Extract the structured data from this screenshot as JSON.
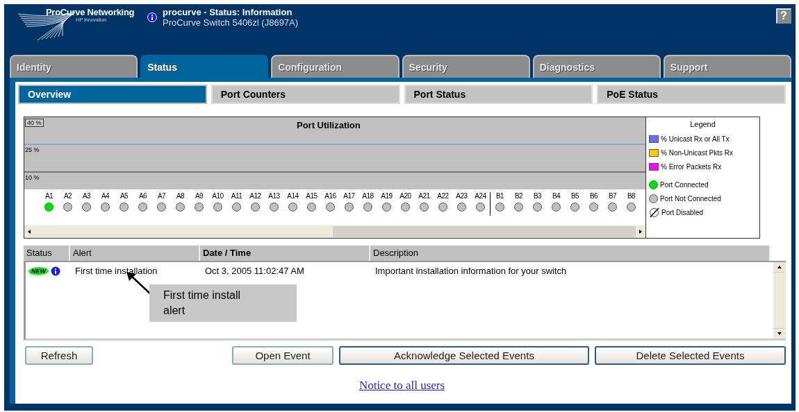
{
  "header": {
    "brand": "ProCurve Networking",
    "tagline": "HP Innovation",
    "title": "procurve -  Status: Information",
    "subtitle": "ProCurve Switch 5406zl (J8697A)",
    "help": "?"
  },
  "tabs": [
    {
      "label": "Identity",
      "selected": false
    },
    {
      "label": "Status",
      "selected": true
    },
    {
      "label": "Configuration",
      "selected": false
    },
    {
      "label": "Security",
      "selected": false
    },
    {
      "label": "Diagnostics",
      "selected": false
    },
    {
      "label": "Support",
      "selected": false
    }
  ],
  "subtabs": [
    {
      "label": "Overview",
      "selected": true
    },
    {
      "label": "Port Counters",
      "selected": false
    },
    {
      "label": "Port Status",
      "selected": false
    },
    {
      "label": "PoE Status",
      "selected": false
    }
  ],
  "utilization": {
    "title": "Port Utilization",
    "scale_labels": [
      "40 %",
      "25 %",
      "10 %"
    ],
    "ports": [
      {
        "label": "A1",
        "connected": true
      },
      {
        "label": "A2",
        "connected": false
      },
      {
        "label": "A3",
        "connected": false
      },
      {
        "label": "A4",
        "connected": false
      },
      {
        "label": "A5",
        "connected": false
      },
      {
        "label": "A6",
        "connected": false
      },
      {
        "label": "A7",
        "connected": false
      },
      {
        "label": "A8",
        "connected": false
      },
      {
        "label": "A9",
        "connected": false
      },
      {
        "label": "A10",
        "connected": false
      },
      {
        "label": "A11",
        "connected": false
      },
      {
        "label": "A12",
        "connected": false
      },
      {
        "label": "A13",
        "connected": false
      },
      {
        "label": "A14",
        "connected": false
      },
      {
        "label": "A15",
        "connected": false
      },
      {
        "label": "A16",
        "connected": false
      },
      {
        "label": "A17",
        "connected": false
      },
      {
        "label": "A18",
        "connected": false
      },
      {
        "label": "A19",
        "connected": false
      },
      {
        "label": "A20",
        "connected": false
      },
      {
        "label": "A21",
        "connected": false
      },
      {
        "label": "A22",
        "connected": false
      },
      {
        "label": "A23",
        "connected": false
      },
      {
        "label": "A24",
        "connected": false
      },
      {
        "label": "B1",
        "connected": false
      },
      {
        "label": "B2",
        "connected": false
      },
      {
        "label": "B3",
        "connected": false
      },
      {
        "label": "B4",
        "connected": false
      },
      {
        "label": "B5",
        "connected": false
      },
      {
        "label": "B6",
        "connected": false
      },
      {
        "label": "B7",
        "connected": false
      },
      {
        "label": "B8",
        "connected": false
      }
    ],
    "legend": {
      "title": "Legend",
      "items": [
        {
          "kind": "swatch",
          "color": "#6b6bff",
          "label": "% Unicast Rx or All Tx"
        },
        {
          "kind": "swatch",
          "color": "#ffcc00",
          "label": "% Non-Unicast Pkts Rx"
        },
        {
          "kind": "swatch",
          "color": "#ff00ff",
          "label": "% Error Packets Rx"
        },
        {
          "kind": "port",
          "connected": true,
          "disabled": false,
          "label": "Port Connected"
        },
        {
          "kind": "port",
          "connected": false,
          "disabled": false,
          "label": "Port Not Connected"
        },
        {
          "kind": "port",
          "connected": false,
          "disabled": true,
          "label": "Port Disabled"
        }
      ]
    }
  },
  "alerts": {
    "columns": [
      "Status",
      "Alert",
      "Date / Time",
      "Description"
    ],
    "rows": [
      {
        "badge": "NEW",
        "alert": "First time installation",
        "date_time": "Oct 3, 2005 11:02:47 AM",
        "description": "Important installation information for your switch"
      }
    ]
  },
  "callout": "First time install alert",
  "buttons": [
    "Refresh",
    "Open Event",
    "Acknowledge Selected Events",
    "Delete Selected Events"
  ],
  "notice_link": "Notice to all users"
}
